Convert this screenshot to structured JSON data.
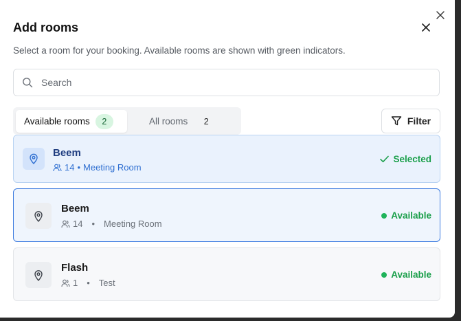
{
  "dialog": {
    "title": "Add rooms",
    "subtitle": "Select a room for your booking. Available rooms are shown with green indicators."
  },
  "search": {
    "placeholder": "Search",
    "value": ""
  },
  "tabs": [
    {
      "label": "Available rooms",
      "count": "2",
      "active": true
    },
    {
      "label": "All rooms",
      "count": "2",
      "active": false
    }
  ],
  "filter": {
    "label": "Filter"
  },
  "rooms": [
    {
      "name": "Beem",
      "capacity": "14",
      "separator": "•",
      "type": "Meeting Room",
      "status": "Selected"
    },
    {
      "name": "Beem",
      "capacity": "14",
      "separator": "•",
      "type": "Meeting Room",
      "status": "Available"
    },
    {
      "name": "Flash",
      "capacity": "1",
      "separator": "•",
      "type": "Test",
      "status": "Available"
    }
  ],
  "colors": {
    "available": "#1fb35a",
    "selected_bg": "#eaf2fd",
    "accent_border": "#3f7de0"
  },
  "icons": [
    "close-icon",
    "search-icon",
    "filter-icon",
    "map-pin-icon",
    "people-icon",
    "check-icon"
  ]
}
